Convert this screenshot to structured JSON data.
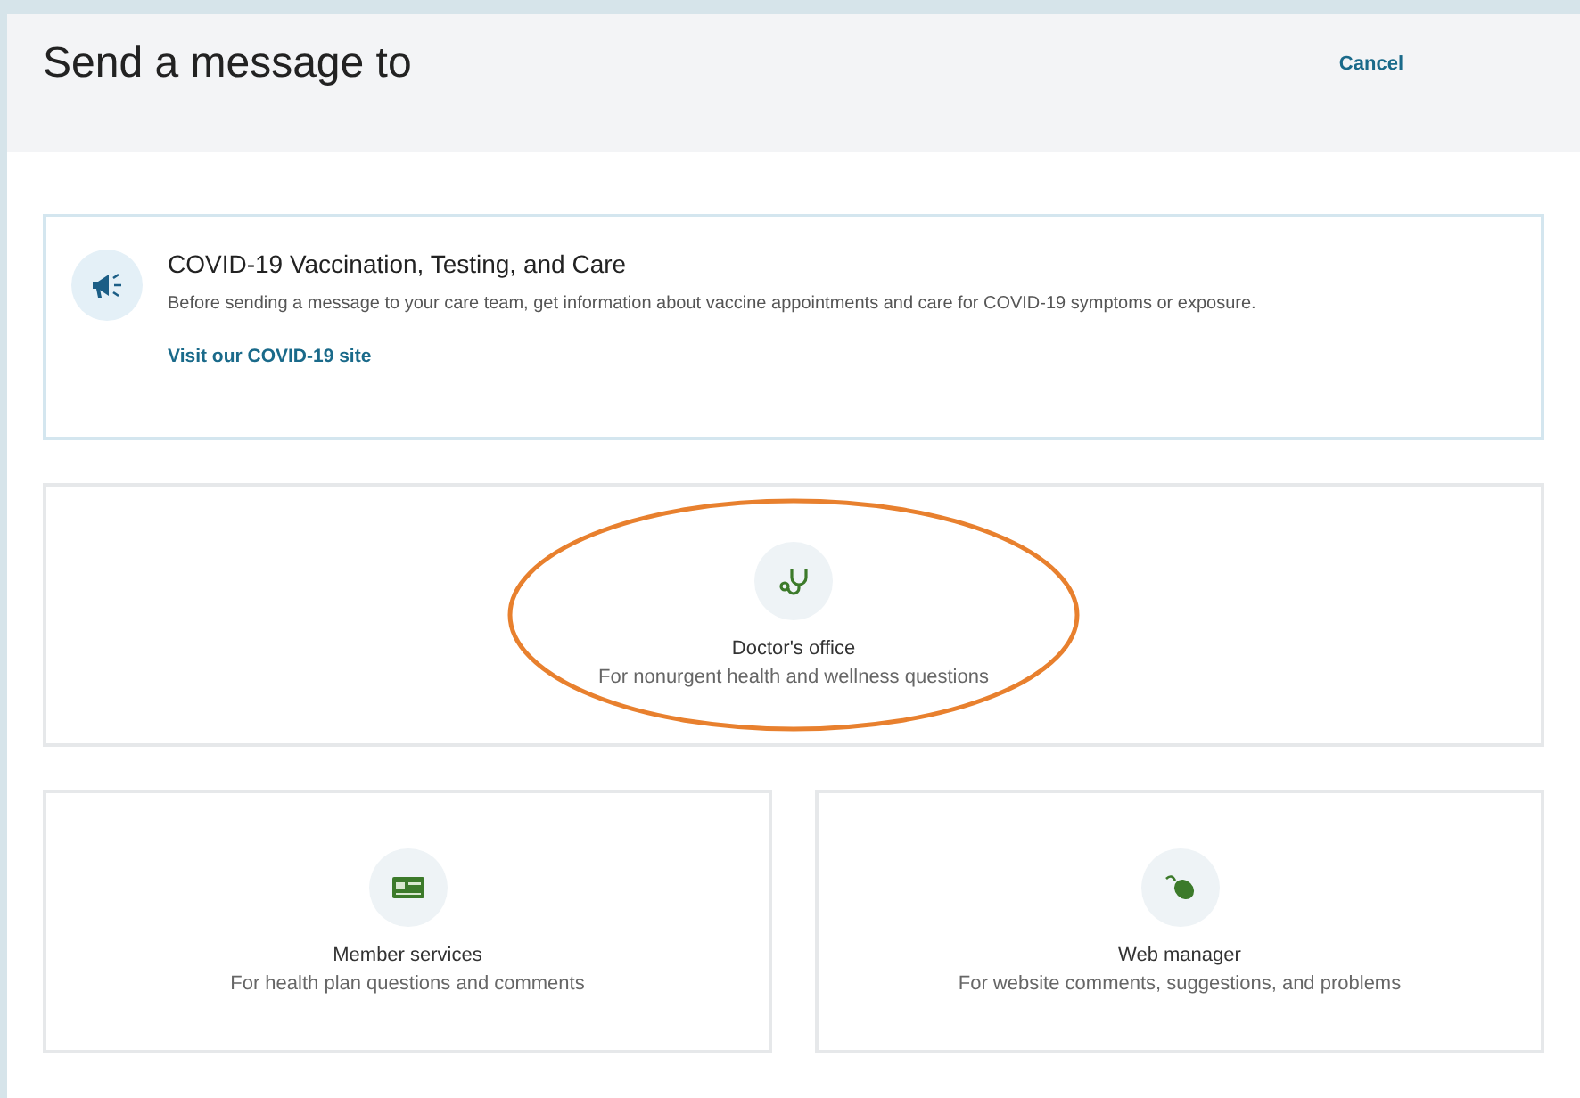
{
  "header": {
    "title": "Send a message to",
    "cancel": "Cancel"
  },
  "banner": {
    "title": "COVID-19 Vaccination, Testing, and Care",
    "text": "Before sending a message to your care team, get information about vaccine appointments and care for COVID-19 symptoms or exposure.",
    "link": "Visit our COVID-19 site"
  },
  "options": [
    {
      "kind": "stethoscope",
      "title": "Doctor's office",
      "subtitle": "For nonurgent health and wellness questions",
      "highlighted": true
    },
    {
      "kind": "card",
      "title": "Member services",
      "subtitle": "For health plan questions and comments",
      "highlighted": false
    },
    {
      "kind": "mouse",
      "title": "Web manager",
      "subtitle": "For website comments, suggestions, and problems",
      "highlighted": false
    }
  ]
}
